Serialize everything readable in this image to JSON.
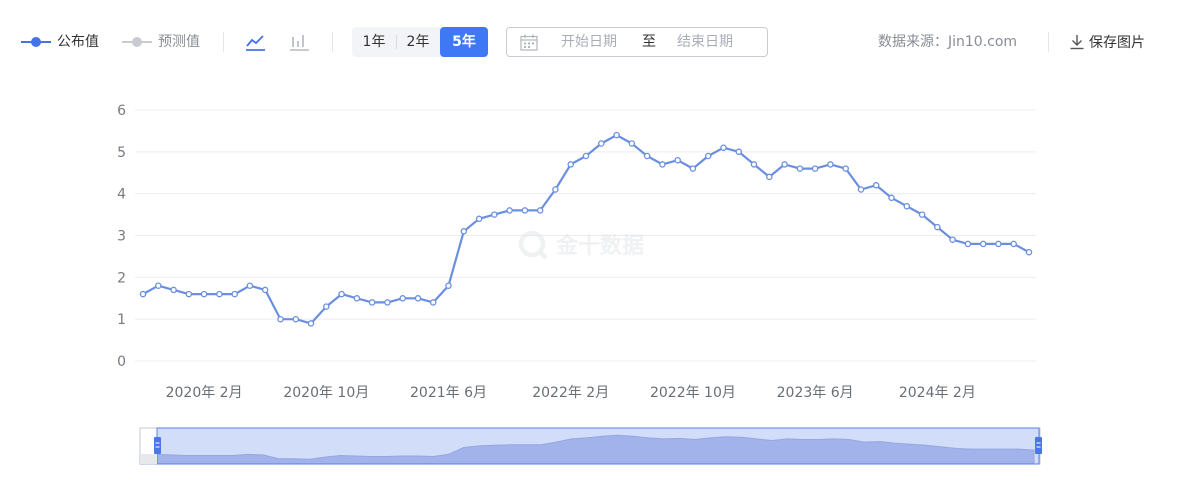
{
  "legend": {
    "published_label": "公布值",
    "forecast_label": "预测值",
    "published_color": "#4472e8",
    "forecast_color": "#c8cbd0"
  },
  "chart_type_icons": [
    "line-chart-icon",
    "bar-chart-icon"
  ],
  "range_buttons": {
    "one_year": "1年",
    "two_year": "2年",
    "five_year": "5年",
    "active": "5年"
  },
  "date_picker": {
    "start_placeholder": "开始日期",
    "separator": "至",
    "end_placeholder": "结束日期"
  },
  "source_text": "数据来源：Jin10.com",
  "save_label": "保存图片",
  "watermark_text": "金十数据",
  "chart_data": {
    "type": "line",
    "title": "",
    "xlabel": "",
    "ylabel": "",
    "ylim": [
      0,
      6
    ],
    "yticks": [
      "0",
      "1",
      "2",
      "3",
      "4",
      "5",
      "6"
    ],
    "grid": true,
    "line_color": "#6b8fe0",
    "x_tick_labels": [
      {
        "label": "2020年 2月",
        "index": 4
      },
      {
        "label": "2020年 10月",
        "index": 12
      },
      {
        "label": "2021年 6月",
        "index": 20
      },
      {
        "label": "2022年 2月",
        "index": 28
      },
      {
        "label": "2022年 10月",
        "index": 36
      },
      {
        "label": "2023年 6月",
        "index": 44
      },
      {
        "label": "2024年 2月",
        "index": 52
      }
    ],
    "series": [
      {
        "values": [
          1.6,
          1.8,
          1.7,
          1.6,
          1.6,
          1.6,
          1.6,
          1.8,
          1.7,
          1.0,
          1.0,
          0.9,
          1.3,
          1.6,
          1.5,
          1.4,
          1.4,
          1.5,
          1.5,
          1.4,
          1.8,
          3.1,
          3.4,
          3.5,
          3.6,
          3.6,
          3.6,
          4.1,
          4.7,
          4.9,
          5.2,
          5.4,
          5.2,
          4.9,
          4.7,
          4.8,
          4.6,
          4.9,
          5.1,
          5.0,
          4.7,
          4.4,
          4.7,
          4.6,
          4.6,
          4.7,
          4.6,
          4.1,
          4.2,
          3.9,
          3.7,
          3.5,
          3.2,
          2.9,
          2.8,
          2.8,
          2.8,
          2.8,
          2.6
        ]
      }
    ]
  }
}
